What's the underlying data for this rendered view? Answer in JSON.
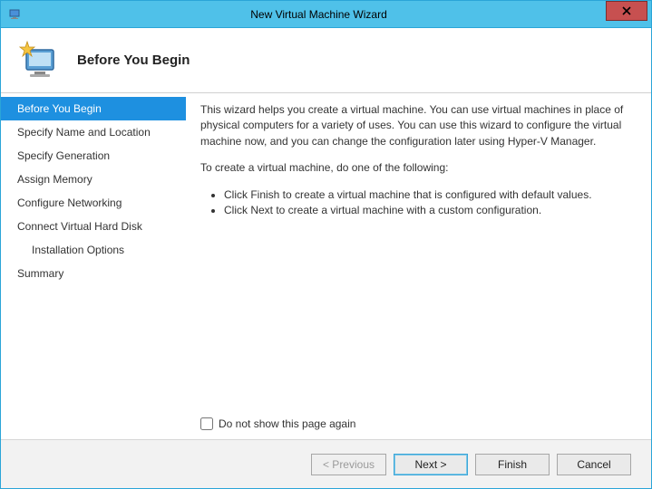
{
  "window": {
    "title": "New Virtual Machine Wizard",
    "close_label": "X"
  },
  "header": {
    "title": "Before You Begin"
  },
  "sidebar": {
    "items": [
      {
        "label": "Before You Begin",
        "selected": true
      },
      {
        "label": "Specify Name and Location"
      },
      {
        "label": "Specify Generation"
      },
      {
        "label": "Assign Memory"
      },
      {
        "label": "Configure Networking"
      },
      {
        "label": "Connect Virtual Hard Disk"
      },
      {
        "label": "Installation Options",
        "indent": true
      },
      {
        "label": "Summary"
      }
    ]
  },
  "content": {
    "intro": "This wizard helps you create a virtual machine. You can use virtual machines in place of physical computers for a variety of uses. You can use this wizard to configure the virtual machine now, and you can change the configuration later using Hyper-V Manager.",
    "instruction": "To create a virtual machine, do one of the following:",
    "bullets": [
      "Click Finish to create a virtual machine that is configured with default values.",
      "Click Next to create a virtual machine with a custom configuration."
    ],
    "checkbox_label": "Do not show this page again",
    "checkbox_checked": false
  },
  "footer": {
    "previous": "< Previous",
    "next": "Next >",
    "finish": "Finish",
    "cancel": "Cancel"
  }
}
